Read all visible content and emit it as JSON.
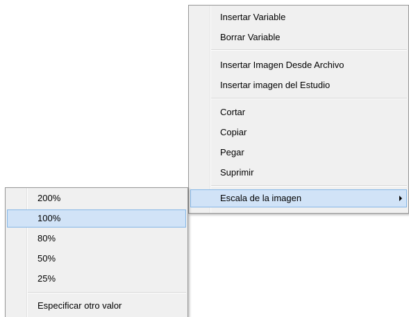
{
  "main_menu": {
    "groups": [
      [
        "Insertar Variable",
        "Borrar Variable"
      ],
      [
        "Insertar Imagen Desde Archivo",
        "Insertar imagen del Estudio"
      ],
      [
        "Cortar",
        "Copiar",
        "Pegar",
        "Suprimir"
      ],
      [
        "Escala de la imagen"
      ]
    ],
    "items": {
      "insert_variable": "Insertar Variable",
      "delete_variable": "Borrar Variable",
      "insert_image_file": "Insertar Imagen Desde Archivo",
      "insert_image_studio": "Insertar imagen del Estudio",
      "cut": "Cortar",
      "copy": "Copiar",
      "paste": "Pegar",
      "delete": "Suprimir",
      "image_scale": "Escala de la imagen"
    },
    "highlighted_item": "Escala de la imagen",
    "submenu_arrow_icon": "chevron-right-icon"
  },
  "scale_submenu": {
    "items": {
      "s200": "200%",
      "s100": "100%",
      "s80": "80%",
      "s50": "50%",
      "s25": "25%",
      "custom": "Especificar otro valor"
    },
    "highlighted_item": "100%"
  },
  "colors": {
    "menu_background": "#f0f0f0",
    "menu_border": "#979797",
    "highlight_fill": "#d1e3f7",
    "highlight_border": "#85b6e6"
  }
}
